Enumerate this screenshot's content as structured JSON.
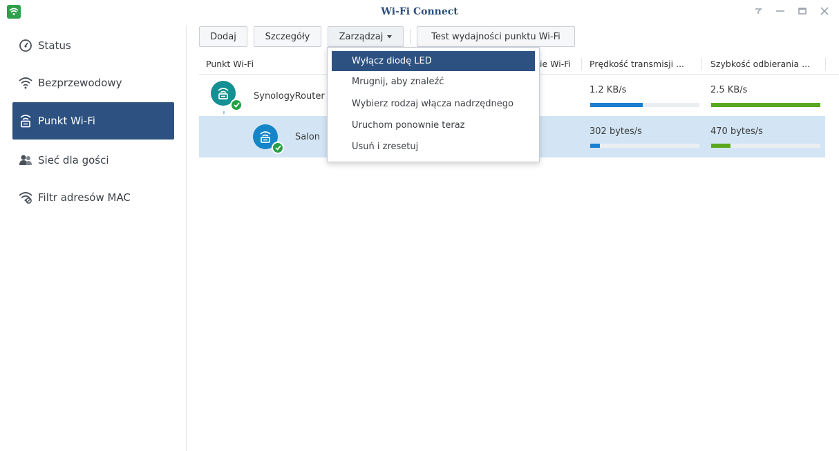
{
  "window": {
    "title": "Wi-Fi Connect"
  },
  "sidebar": {
    "items": [
      {
        "label": "Status",
        "icon": "status-icon"
      },
      {
        "label": "Bezprzewodowy",
        "icon": "wifi-icon"
      },
      {
        "label": "Punkt Wi-Fi",
        "icon": "router-icon",
        "active": true
      },
      {
        "label": "Sieć dla gości",
        "icon": "guest-icon"
      },
      {
        "label": "Filtr adresów MAC",
        "icon": "mac-filter-icon"
      }
    ]
  },
  "toolbar": {
    "add_label": "Dodaj",
    "details_label": "Szczegóły",
    "manage_label": "Zarządzaj",
    "test_label": "Test wydajności punktu Wi-Fi"
  },
  "table": {
    "columns": [
      "Punkt Wi-Fi",
      "ie Wi-Fi",
      "Prędkość transmisji ...",
      "Szybkość odbierania ..."
    ],
    "rows": [
      {
        "name": "SynologyRouter",
        "tx": "1.2 KB/s",
        "rx": "2.5 KB/s",
        "tx_fill": 0.48,
        "rx_fill": 1.0
      },
      {
        "name": "Salon",
        "tx": "302 bytes/s",
        "rx": "470 bytes/s",
        "tx_fill": 0.09,
        "rx_fill": 0.18
      }
    ]
  },
  "menu": {
    "items": [
      "Wyłącz diodę LED",
      "Mrugnij, aby znaleźć",
      "Wybierz rodzaj włącza nadrzędnego",
      "Uruchom ponownie teraz",
      "Usuń i zresetuj"
    ]
  },
  "colors": {
    "accent": "#2d5282",
    "selected_row": "#d3e5f5",
    "tx_bar": "#1a7fd0",
    "rx_bar": "#5aa81f"
  }
}
